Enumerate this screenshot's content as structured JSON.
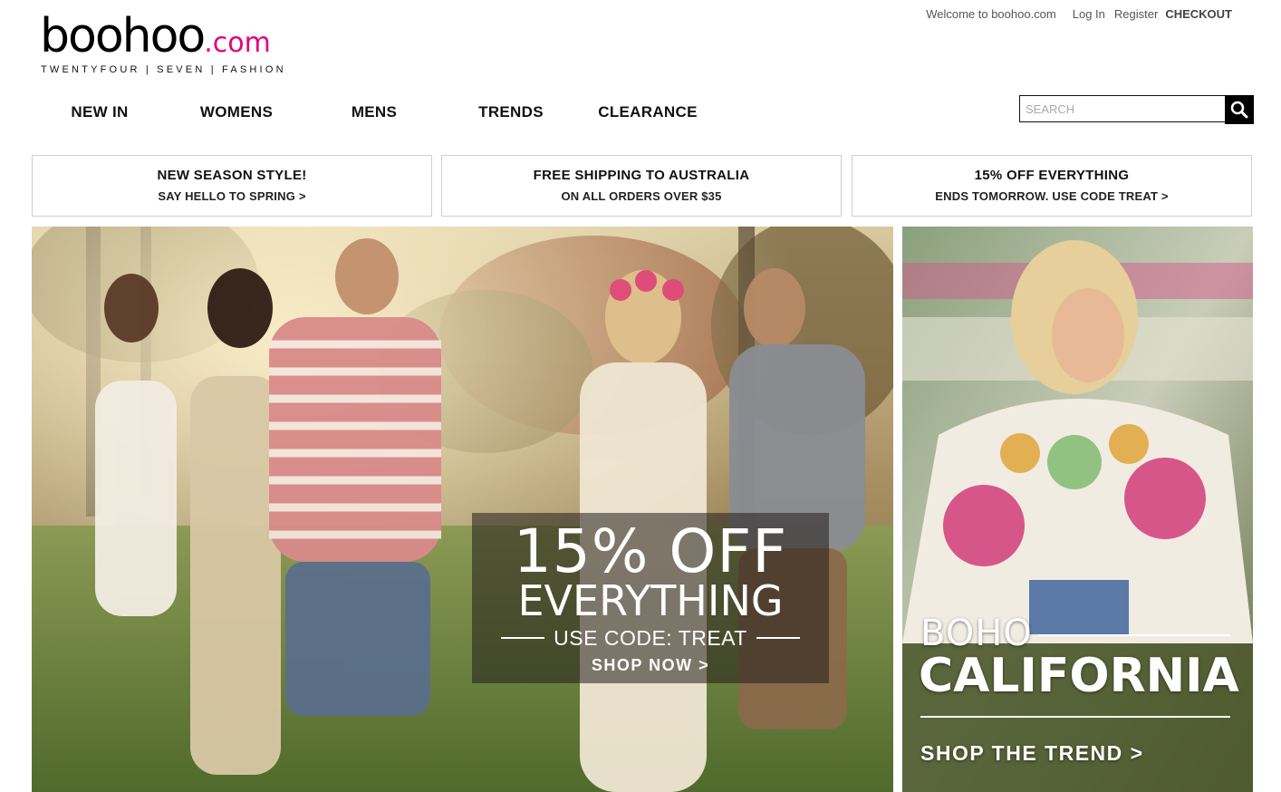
{
  "logo": {
    "main": "boohoo",
    "suffix": ".com",
    "tagline": "TWENTYFOUR | SEVEN | FASHION"
  },
  "top_links": {
    "welcome": "Welcome to boohoo.com",
    "login": "Log In",
    "register": "Register",
    "checkout": "CHECKOUT"
  },
  "nav": {
    "items": [
      "NEW IN",
      "WOMENS",
      "MENS",
      "TRENDS",
      "CLEARANCE"
    ]
  },
  "search": {
    "placeholder": "SEARCH",
    "icon": "search-icon"
  },
  "promos": [
    {
      "title": "NEW SEASON STYLE!",
      "subtitle": "SAY HELLO TO SPRING >"
    },
    {
      "title": "FREE SHIPPING TO AUSTRALIA",
      "subtitle": "ON ALL ORDERS OVER $35"
    },
    {
      "title": "15% OFF EVERYTHING",
      "subtitle": "ENDS TOMORROW. USE CODE TREAT >"
    }
  ],
  "hero_main": {
    "line1": "15% OFF",
    "line2": "EVERYTHING",
    "line3": "USE CODE: TREAT",
    "cta": "SHOP NOW >"
  },
  "hero_side": {
    "line1": "BOHO",
    "line2": "CALIFORNIA",
    "cta": "SHOP THE TREND >"
  },
  "colors": {
    "brand_pink": "#e4007c",
    "text": "#111111",
    "border": "#cfcfcf"
  }
}
